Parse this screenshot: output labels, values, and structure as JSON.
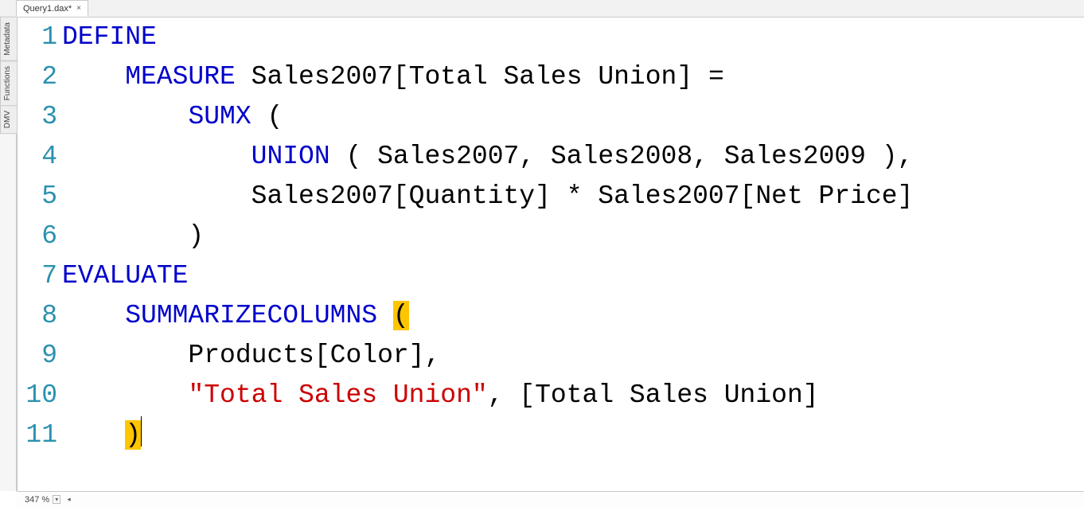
{
  "tab": {
    "label": "Query1.dax*",
    "close_glyph": "×"
  },
  "side_rail": {
    "items": [
      "Metadata",
      "Functions",
      "DMV"
    ]
  },
  "status": {
    "zoom": "347 %",
    "dropdown_glyph": "▾",
    "scroll_left_glyph": "◂"
  },
  "code": {
    "line_count": 11,
    "tokens": [
      [
        {
          "t": "DEFINE",
          "c": "kw"
        }
      ],
      [
        {
          "t": "    "
        },
        {
          "t": "MEASURE",
          "c": "kw"
        },
        {
          "t": " Sales2007[Total Sales Union] ="
        }
      ],
      [
        {
          "t": "        "
        },
        {
          "t": "SUMX",
          "c": "kw"
        },
        {
          "t": " ("
        }
      ],
      [
        {
          "t": "            "
        },
        {
          "t": "UNION",
          "c": "kw"
        },
        {
          "t": " ( Sales2007, Sales2008, Sales2009 ),"
        }
      ],
      [
        {
          "t": "            Sales2007[Quantity] * Sales2007[Net Price]"
        }
      ],
      [
        {
          "t": "        )"
        }
      ],
      [
        {
          "t": "EVALUATE",
          "c": "kw"
        }
      ],
      [
        {
          "t": "    "
        },
        {
          "t": "SUMMARIZECOLUMNS",
          "c": "kw"
        },
        {
          "t": " "
        },
        {
          "t": "(",
          "c": "hp"
        }
      ],
      [
        {
          "t": "        Products[Color],"
        }
      ],
      [
        {
          "t": "        "
        },
        {
          "t": "\"Total Sales Union\"",
          "c": "str"
        },
        {
          "t": ", [Total Sales Union]"
        }
      ],
      [
        {
          "t": "    "
        },
        {
          "t": ")",
          "c": "hp"
        },
        {
          "t": "",
          "cursor": true
        }
      ]
    ]
  }
}
